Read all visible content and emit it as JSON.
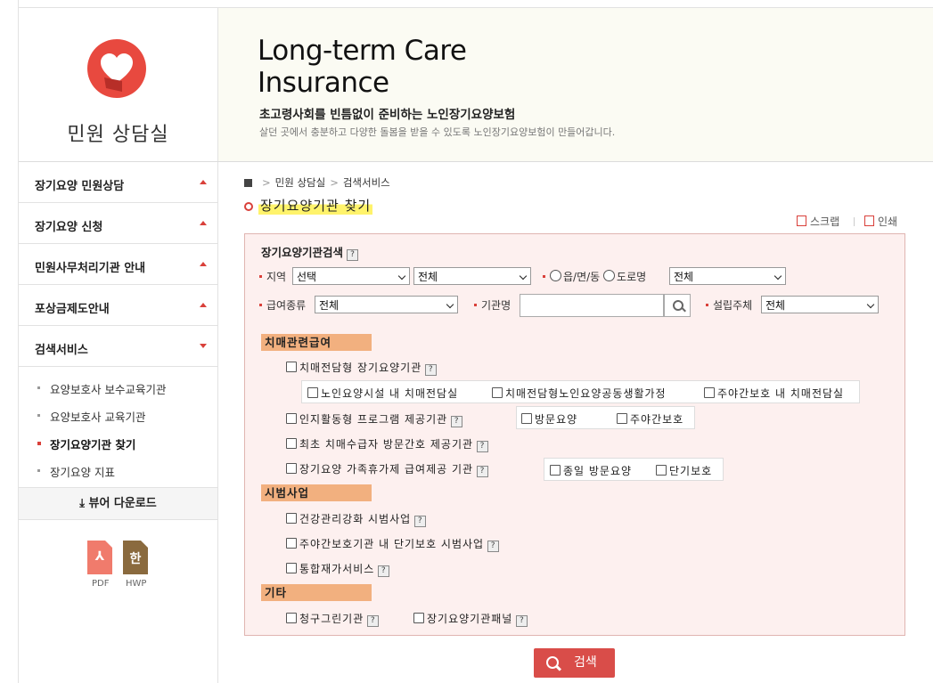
{
  "logo": {
    "title": "민원 상담실"
  },
  "banner": {
    "title_line1": "Long-term Care",
    "title_line2": "Insurance",
    "subtitle": "초고령사회를 빈틈없이 준비하는 노인장기요양보험",
    "description": "살던 곳에서 충분하고 다양한 돌봄을 받을 수 있도록 노인장기요양보험이 만들어갑니다."
  },
  "sidebar": {
    "items": [
      {
        "label": "장기요양 민원상담"
      },
      {
        "label": "장기요양 신청"
      },
      {
        "label": "민원사무처리기관 안내"
      },
      {
        "label": "포상금제도안내"
      },
      {
        "label": "검색서비스"
      }
    ],
    "subitems": [
      {
        "label": "요양보호사 보수교육기관"
      },
      {
        "label": "요양보호사 교육기관"
      },
      {
        "label": "장기요양기관 찾기"
      },
      {
        "label": "장기요양 지표"
      }
    ],
    "download_label": "뷰어 다운로드",
    "files": [
      {
        "label": "PDF",
        "glyph": "⅄"
      },
      {
        "label": "HWP",
        "glyph": "한"
      }
    ]
  },
  "breadcrumb": {
    "items": [
      "민원 상담실",
      "검색서비스"
    ]
  },
  "page_title": "장기요양기관 찾기",
  "utils": {
    "scrap": "스크랩",
    "print": "인쇄"
  },
  "form": {
    "title": "장기요양기관검색",
    "help": "?",
    "region_label": "지역",
    "region_select1": "선택",
    "region_select2": "전체",
    "radio1": "읍/면/동",
    "radio2": "도로명",
    "road_select": "전체",
    "benefit_label": "급여종류",
    "benefit_select": "전체",
    "org_name_label": "기관명",
    "org_name_value": "",
    "founder_label": "설립주체",
    "founder_select": "전체",
    "sections": {
      "dementia": "치매관련급여",
      "pilot": "시범사업",
      "etc": "기타"
    },
    "checks": {
      "c1": "치매전담형 장기요양기관",
      "c1a": "노인요양시설 내 치매전담실",
      "c1b": "치매전담형노인요양공동생활가정",
      "c1c": "주야간보호 내 치매전담실",
      "c2": "인지활동형 프로그램 제공기관",
      "c2a": "방문요양",
      "c2b": "주야간보호",
      "c3": "최초 치매수급자 방문간호 제공기관",
      "c4": "장기요양 가족휴가제 급여제공 기관",
      "c4a": "종일 방문요양",
      "c4b": "단기보호",
      "p1": "건강관리강화 시범사업",
      "p2": "주야간보호기관 내 단기보호 시범사업",
      "p3": "통합재가서비스",
      "e1": "청구그린기관",
      "e2": "장기요양기관패널"
    },
    "search_button": "검색"
  }
}
